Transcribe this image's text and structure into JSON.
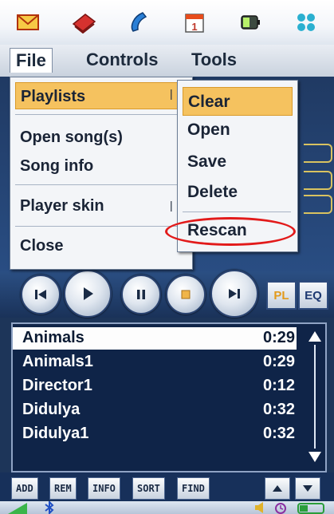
{
  "topbar": {
    "icons": [
      "envelope-icon",
      "book-icon",
      "phone-icon",
      "calendar-icon",
      "battery-icon",
      "apps-grid-icon"
    ],
    "calendar_day": "1"
  },
  "menubar": {
    "file": "File",
    "controls": "Controls",
    "tools": "Tools"
  },
  "file_menu": {
    "items": [
      "Playlists",
      "Open song(s)",
      "Song info",
      "Player skin",
      "Close"
    ]
  },
  "playlists_submenu": {
    "items": [
      "Clear",
      "Open",
      "Save",
      "Delete",
      "Rescan"
    ]
  },
  "transport": {
    "pl_label": "PL",
    "eq_label": "EQ"
  },
  "playlist": {
    "rows": [
      {
        "name": "Animals",
        "time": "0:29"
      },
      {
        "name": "Animals1",
        "time": "0:29"
      },
      {
        "name": "Director1",
        "time": "0:12"
      },
      {
        "name": "Didulya",
        "time": "0:32"
      },
      {
        "name": "Didulya1",
        "time": "0:32"
      }
    ]
  },
  "playlist_buttons": {
    "add": "ADD",
    "rem": "REM",
    "info": "INFO",
    "sort": "SORT",
    "find": "FIND"
  },
  "colors": {
    "highlight": "#f5c25f",
    "annotation_circle": "#e21a1a",
    "panel": "#1d3559"
  }
}
